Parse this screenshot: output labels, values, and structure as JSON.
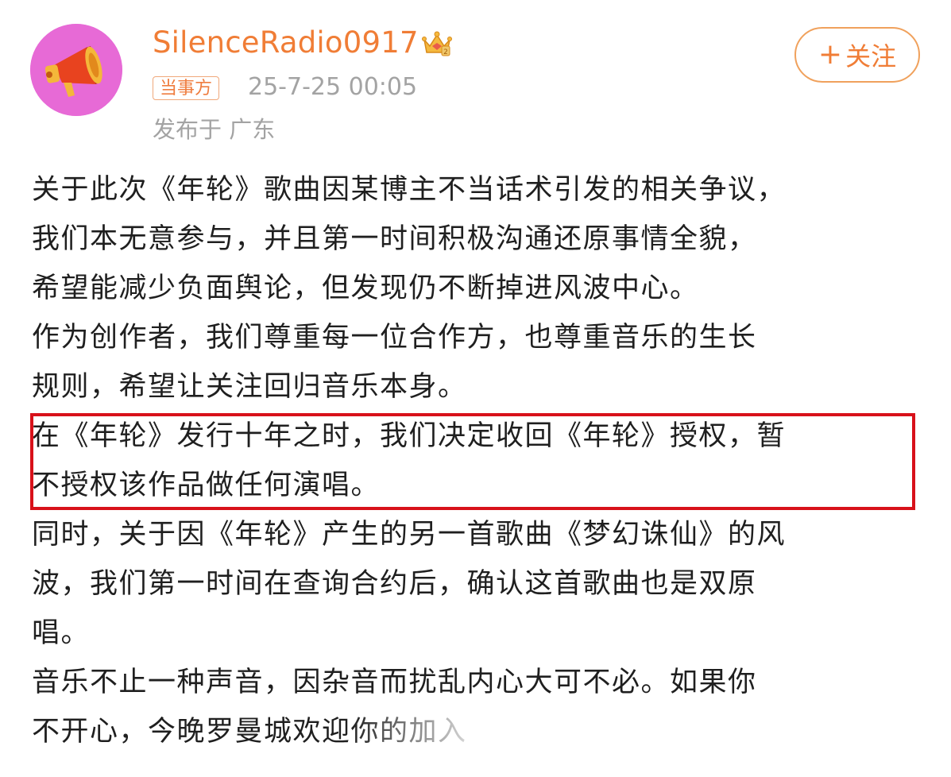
{
  "post": {
    "author": {
      "username": "SilenceRadio0917",
      "badge_icon": "crown-vip-icon",
      "avatar_icon": "megaphone-icon",
      "avatar_bg": "#e76ad6"
    },
    "tag": "当事方",
    "timestamp": "25-7-25 00:05",
    "location": "发布于 广东",
    "follow_label": "关注",
    "follow_icon": "plus-icon",
    "accent_color": "#f07d36",
    "highlight_color": "#d8111a",
    "body_lines": [
      "关于此次《年轮》歌曲因某博主不当话术引发的相关争议，",
      "我们本无意参与，并且第一时间积极沟通还原事情全貌，",
      "希望能减少负面舆论，但发现仍不断掉进风波中心。",
      "作为创作者，我们尊重每一位合作方，也尊重音乐的生长",
      "规则，希望让关注回归音乐本身。",
      "在《年轮》发行十年之时，我们决定收回《年轮》授权，暂",
      "不授权该作品做任何演唱。",
      "同时，关于因《年轮》产生的另一首歌曲《梦幻诛仙》的风",
      "波，我们第一时间在查询合约后，确认这首歌曲也是双原",
      "唱。",
      "音乐不止一种声音，因杂音而扰乱内心大可不必。如果你",
      "不开心，今晚罗曼城欢迎你的加入"
    ]
  }
}
